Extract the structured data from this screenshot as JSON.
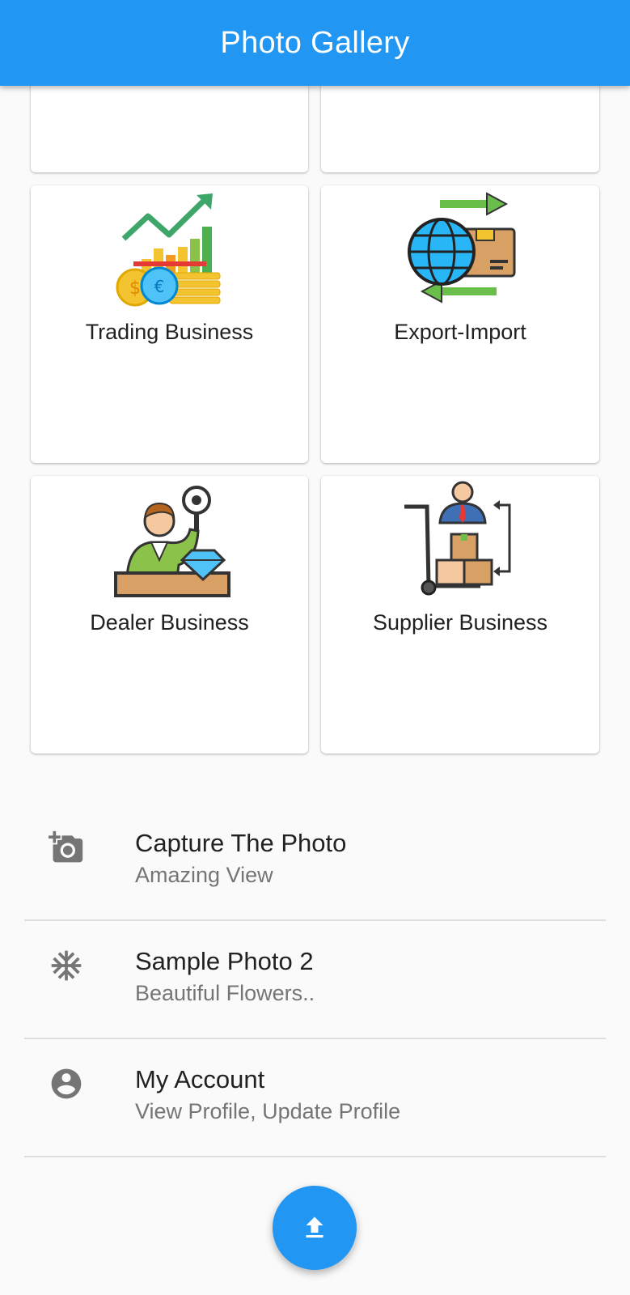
{
  "appbar": {
    "title": "Photo Gallery"
  },
  "grid": {
    "cards": [
      {
        "label": "",
        "icon": "blank"
      },
      {
        "label": "",
        "icon": "blank"
      },
      {
        "label": "Trading Business",
        "icon": "trading-chart-coins-icon"
      },
      {
        "label": "Export-Import",
        "icon": "globe-box-arrows-icon"
      },
      {
        "label": "Dealer Business",
        "icon": "dealer-diamond-icon"
      },
      {
        "label": "Supplier Business",
        "icon": "supplier-hand-truck-icon"
      }
    ]
  },
  "list": {
    "items": [
      {
        "title": "Capture The Photo",
        "subtitle": "Amazing View",
        "icon": "add-a-photo-icon"
      },
      {
        "title": "Sample Photo 2",
        "subtitle": "Beautiful Flowers..",
        "icon": "snowflake-icon"
      },
      {
        "title": "My Account",
        "subtitle": "View Profile, Update Profile",
        "icon": "account-circle-icon"
      }
    ]
  },
  "fab": {
    "icon": "upload-icon"
  },
  "colors": {
    "primary": "#2196f3",
    "background": "#fafafa",
    "text": "#212121",
    "subtext": "#757575",
    "icon": "#757575"
  }
}
